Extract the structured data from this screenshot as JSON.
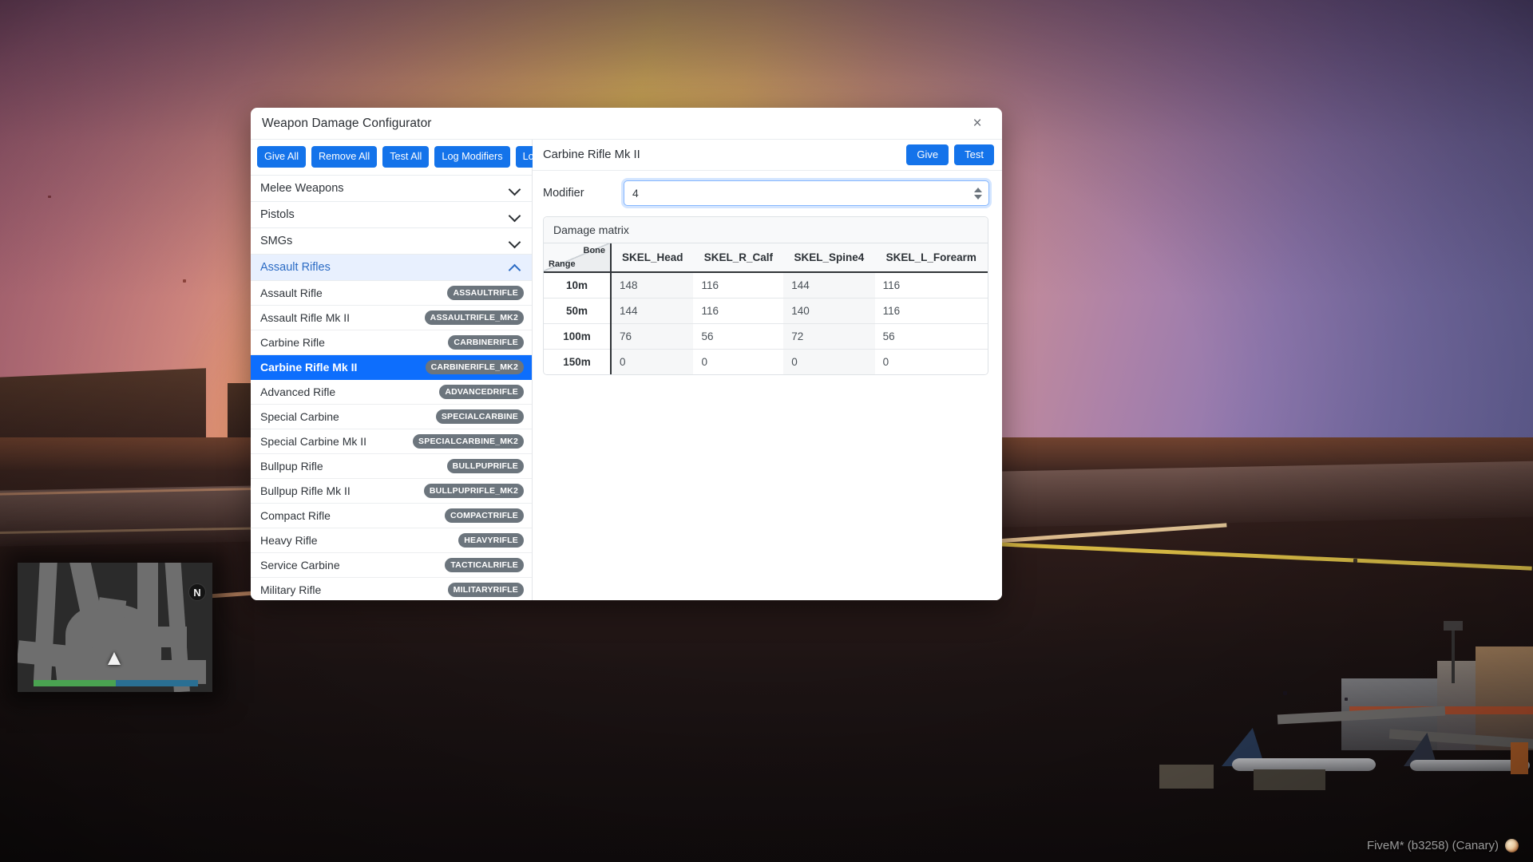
{
  "game": {
    "watermark": "FiveM* (b3258) (Canary)",
    "minimap": {
      "compass": "N"
    },
    "colors": {
      "health_bar": "#4aa351",
      "armor_bar": "#2a6f93",
      "accent_blue": "#0d6efd",
      "toolbar_blue": "#1473ea",
      "badge_gray": "#6c757d",
      "selected_row": "#0d6efd",
      "open_category": "#e8f0fe"
    }
  },
  "modal": {
    "title": "Weapon Damage Configurator",
    "close_icon": "×",
    "toolbar": [
      {
        "label": "Give All",
        "name": "give-all-button"
      },
      {
        "label": "Remove All",
        "name": "remove-all-button"
      },
      {
        "label": "Test All",
        "name": "test-all-button"
      },
      {
        "label": "Log Modifiers",
        "name": "log-modifiers-button"
      },
      {
        "label": "Log CSV",
        "name": "log-csv-button"
      }
    ],
    "categories": [
      {
        "label": "Melee Weapons",
        "open": false
      },
      {
        "label": "Pistols",
        "open": false
      },
      {
        "label": "SMGs",
        "open": false
      },
      {
        "label": "Assault Rifles",
        "open": true
      }
    ],
    "weapons": [
      {
        "name": "Assault Rifle",
        "hash": "ASSAULTRIFLE",
        "selected": false
      },
      {
        "name": "Assault Rifle Mk II",
        "hash": "ASSAULTRIFLE_MK2",
        "selected": false
      },
      {
        "name": "Carbine Rifle",
        "hash": "CARBINERIFLE",
        "selected": false
      },
      {
        "name": "Carbine Rifle Mk II",
        "hash": "CARBINERIFLE_MK2",
        "selected": true
      },
      {
        "name": "Advanced Rifle",
        "hash": "ADVANCEDRIFLE",
        "selected": false
      },
      {
        "name": "Special Carbine",
        "hash": "SPECIALCARBINE",
        "selected": false
      },
      {
        "name": "Special Carbine Mk II",
        "hash": "SPECIALCARBINE_MK2",
        "selected": false
      },
      {
        "name": "Bullpup Rifle",
        "hash": "BULLPUPRIFLE",
        "selected": false
      },
      {
        "name": "Bullpup Rifle Mk II",
        "hash": "BULLPUPRIFLE_MK2",
        "selected": false
      },
      {
        "name": "Compact Rifle",
        "hash": "COMPACTRIFLE",
        "selected": false
      },
      {
        "name": "Heavy Rifle",
        "hash": "HEAVYRIFLE",
        "selected": false
      },
      {
        "name": "Service Carbine",
        "hash": "TACTICALRIFLE",
        "selected": false
      },
      {
        "name": "Military Rifle",
        "hash": "MILITARYRIFLE",
        "selected": false
      }
    ],
    "detail": {
      "title": "Carbine Rifle Mk II",
      "give_label": "Give",
      "test_label": "Test",
      "modifier_label": "Modifier",
      "modifier_value": "4",
      "matrix_title": "Damage matrix"
    },
    "chart_data": {
      "type": "table",
      "title": "Damage matrix",
      "corner_row_label": "Range",
      "corner_col_label": "Bone",
      "columns": [
        "SKEL_Head",
        "SKEL_R_Calf",
        "SKEL_Spine4",
        "SKEL_L_Forearm"
      ],
      "rows": [
        "10m",
        "50m",
        "100m",
        "150m"
      ],
      "values": [
        [
          148,
          116,
          144,
          116
        ],
        [
          144,
          116,
          140,
          116
        ],
        [
          76,
          56,
          72,
          56
        ],
        [
          0,
          0,
          0,
          0
        ]
      ]
    }
  }
}
